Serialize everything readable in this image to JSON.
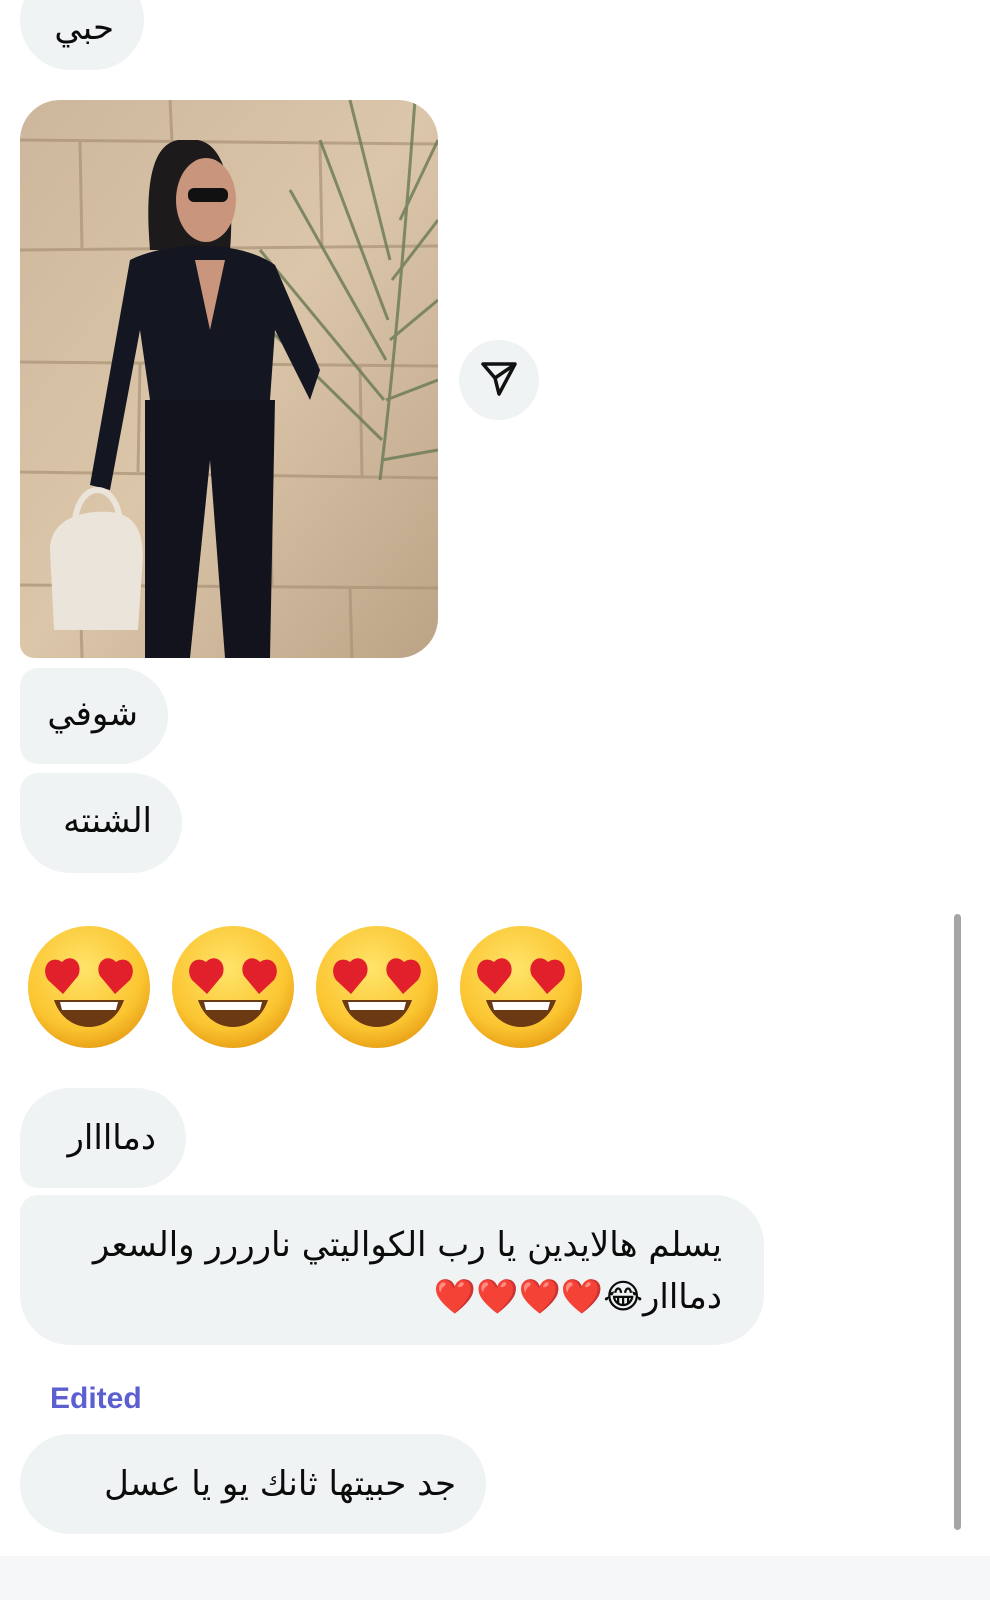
{
  "messages": {
    "m1": "حبي",
    "m2": "شوفي",
    "m3": "الشنته",
    "emoji_reaction": "😍😍😍😍",
    "m4": "دماااار",
    "m5_line1": "يسلم هالايدين يا رب الكواليتي نارررر والسعر",
    "m5_line2": "دمااار😂❤️❤️❤️❤️",
    "edited_label": "Edited",
    "m6": "جد حبيتها ثانك يو يا عسل"
  },
  "icons": {
    "share": "paper-plane-icon",
    "emoji": "heart-eyes-emoji",
    "heart": "red-heart-emoji",
    "laugh": "tears-of-joy-emoji"
  },
  "colors": {
    "bubble": "#eff3f4",
    "edited": "#5b5fd0",
    "heart": "#e1202c"
  }
}
